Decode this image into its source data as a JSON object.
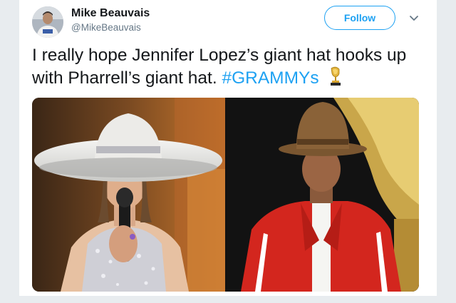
{
  "tweet": {
    "author_name": "Mike Beauvais",
    "author_handle": "@MikeBeauvais",
    "follow_label": "Follow",
    "text_main": "I really hope Jennifer Lopez’s giant hat hooks up with Pharrell’s giant hat.",
    "hashtag": "#GRAMMYs"
  },
  "icons": {
    "avatar": "user-avatar",
    "menu": "chevron-down-icon",
    "emoji": "trophy-icon"
  },
  "colors": {
    "accent": "#1da1f2",
    "text": "#14171a",
    "muted": "#657786"
  }
}
